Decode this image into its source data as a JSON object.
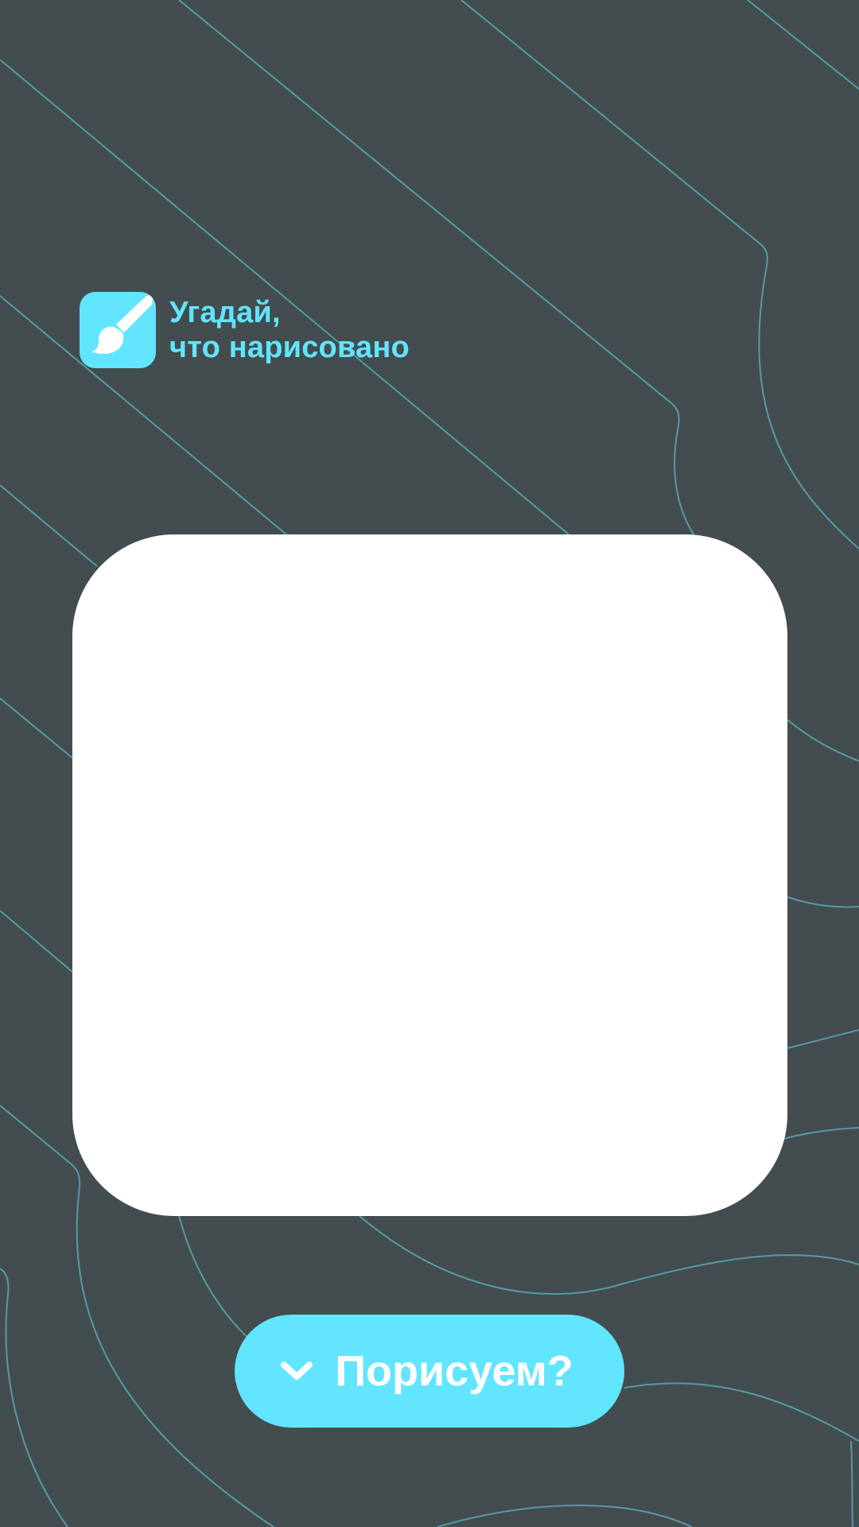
{
  "header": {
    "title_line1": "Угадай,",
    "title_line2": "что нарисовано",
    "icon": "paintbrush-icon"
  },
  "canvas": {
    "label": ""
  },
  "action": {
    "button_label": "Порисуем?",
    "icon": "chevron-down-icon"
  },
  "colors": {
    "background": "#434d4f",
    "accent": "#62e5ff",
    "contour_lines": "#5aa8b6",
    "card": "#ffffff",
    "button_text": "#ffffff"
  }
}
